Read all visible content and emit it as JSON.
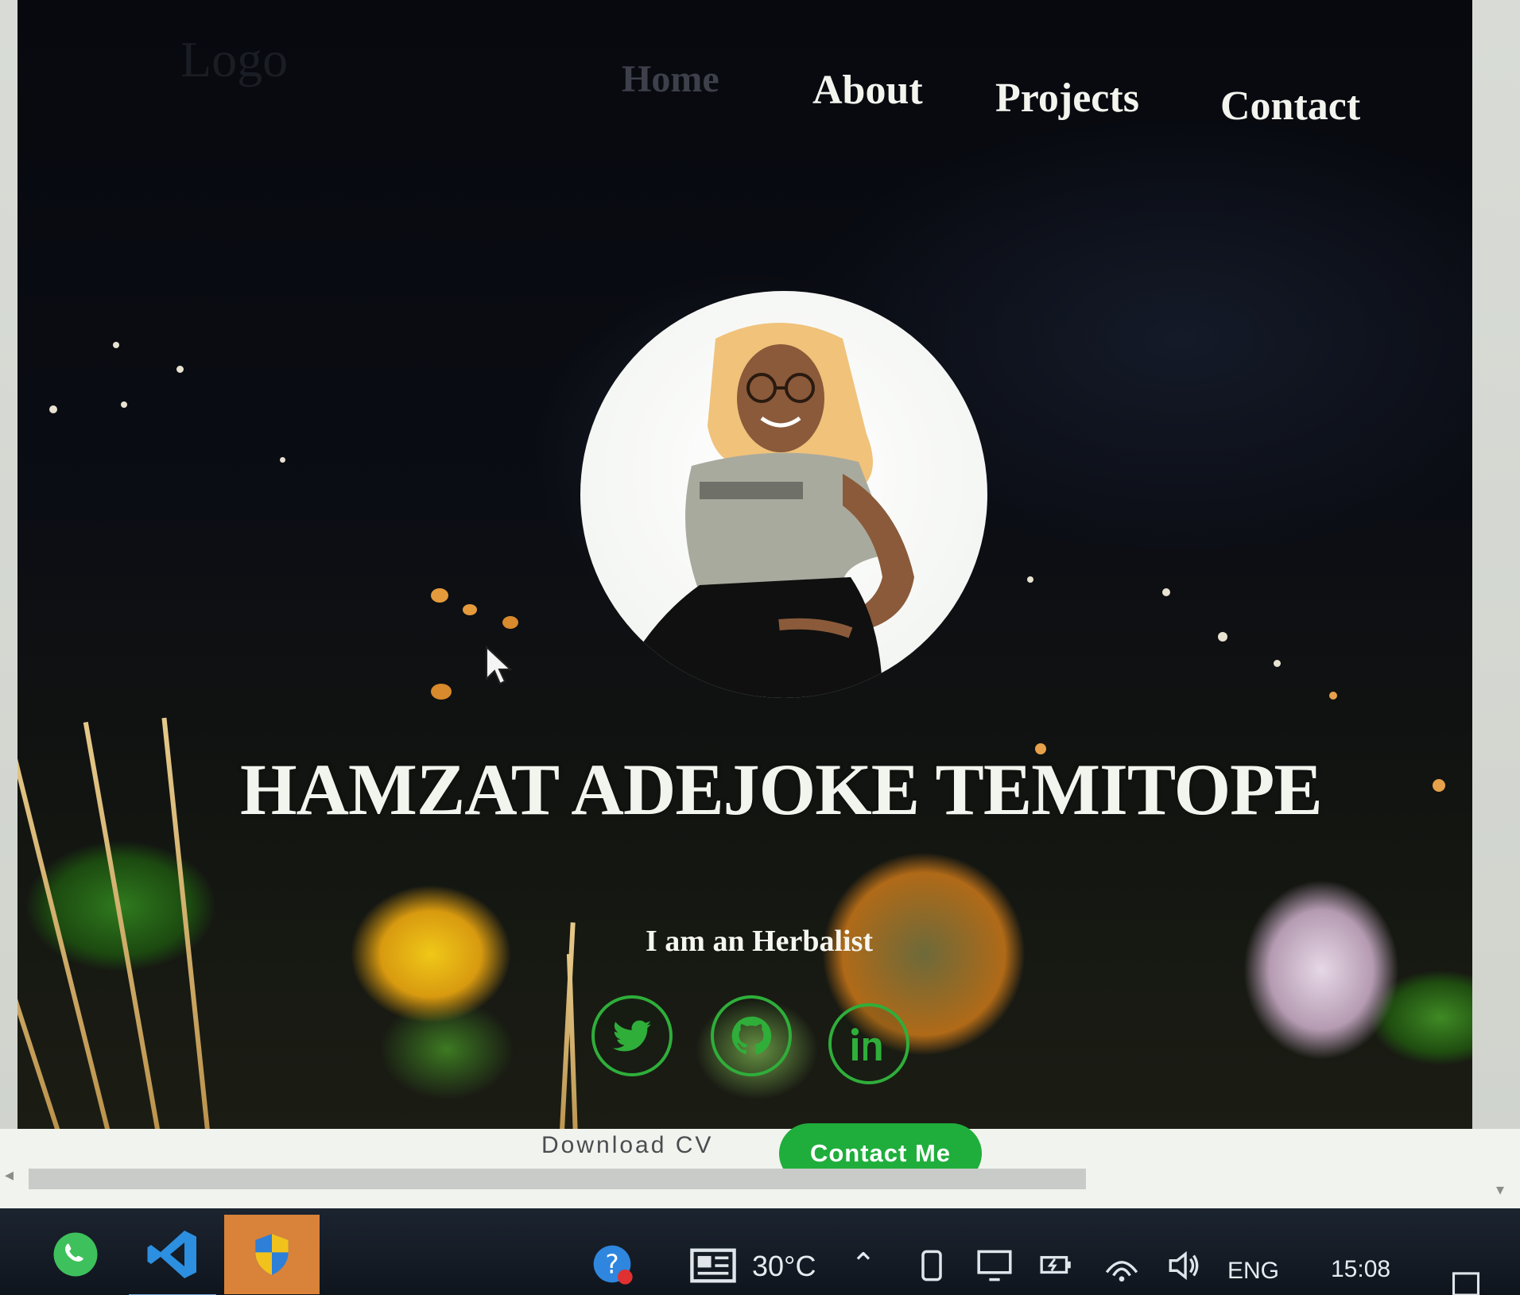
{
  "header": {
    "logo": "Logo",
    "nav": [
      {
        "label": "Home"
      },
      {
        "label": "About"
      },
      {
        "label": "Projects"
      },
      {
        "label": "Contact"
      }
    ]
  },
  "hero": {
    "name": "HAMZAT ADEJOKE TEMITOPE",
    "tagline": "I am an Herbalist"
  },
  "social": [
    {
      "icon": "twitter-icon"
    },
    {
      "icon": "github-icon"
    },
    {
      "icon": "linkedin-icon"
    }
  ],
  "actions": {
    "download_cv": "Download CV",
    "contact_me": "Contact Me"
  },
  "taskbar": {
    "weather": "30°C",
    "language": "ENG",
    "time": "15:08"
  },
  "colors": {
    "accent": "#1fae3c",
    "nav_text": "#f4f4ee",
    "hero_background": "#07090f"
  }
}
